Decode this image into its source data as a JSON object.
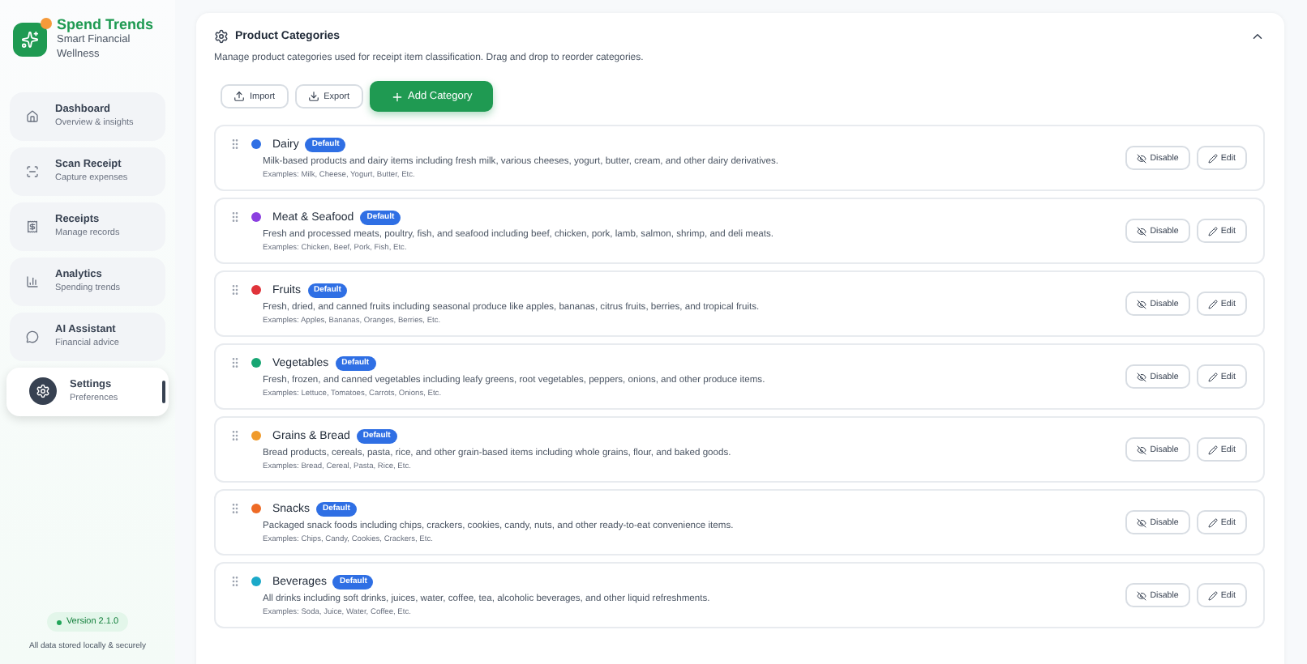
{
  "brand": {
    "name": "Spend Trends",
    "tagline": "Smart Financial Wellness"
  },
  "nav": [
    {
      "kind": "home",
      "label": "Dashboard",
      "sub": "Overview & insights",
      "selected": false
    },
    {
      "kind": "scan",
      "label": "Scan Receipt",
      "sub": "Capture expenses",
      "selected": false
    },
    {
      "kind": "receipt",
      "label": "Receipts",
      "sub": "Manage records",
      "selected": false
    },
    {
      "kind": "chart",
      "label": "Analytics",
      "sub": "Spending trends",
      "selected": false
    },
    {
      "kind": "chat",
      "label": "AI Assistant",
      "sub": "Financial advice",
      "selected": false
    },
    {
      "kind": "gear",
      "label": "Settings",
      "sub": "Preferences",
      "selected": true
    }
  ],
  "footer": {
    "version": "Version 2.1.0",
    "note": "All data stored locally & securely"
  },
  "panel": {
    "title": "Product Categories",
    "description": "Manage product categories used for receipt item classification. Drag and drop to reorder categories.",
    "expanded": true,
    "buttons": [
      {
        "kind": "import",
        "label": "Import"
      },
      {
        "kind": "export",
        "label": "Export"
      },
      {
        "kind": "add",
        "label": "Add Category"
      }
    ],
    "categories": [
      {
        "name": "Dairy",
        "badge": "Default",
        "color": "#2f6fe4",
        "description": "Milk-based products and dairy items including fresh milk, various cheeses, yogurt, butter, cream, and other dairy derivatives.",
        "examples": "Examples: Milk, Cheese, Yogurt, Butter, Etc.",
        "disable": "Disable",
        "edit": "Edit"
      },
      {
        "name": "Meat & Seafood",
        "badge": "Default",
        "color": "#8b3fe0",
        "description": "Fresh and processed meats, poultry, fish, and seafood including beef, chicken, pork, lamb, salmon, shrimp, and deli meats.",
        "examples": "Examples: Chicken, Beef, Pork, Fish, Etc.",
        "disable": "Disable",
        "edit": "Edit"
      },
      {
        "name": "Fruits",
        "badge": "Default",
        "color": "#e0333a",
        "description": "Fresh, dried, and canned fruits including seasonal produce like apples, bananas, citrus fruits, berries, and tropical fruits.",
        "examples": "Examples: Apples, Bananas, Oranges, Berries, Etc.",
        "disable": "Disable",
        "edit": "Edit"
      },
      {
        "name": "Vegetables",
        "badge": "Default",
        "color": "#17a673",
        "description": "Fresh, frozen, and canned vegetables including leafy greens, root vegetables, peppers, onions, and other produce items.",
        "examples": "Examples: Lettuce, Tomatoes, Carrots, Onions, Etc.",
        "disable": "Disable",
        "edit": "Edit"
      },
      {
        "name": "Grains & Bread",
        "badge": "Default",
        "color": "#f09a2a",
        "description": "Bread products, cereals, pasta, rice, and other grain-based items including whole grains, flour, and baked goods.",
        "examples": "Examples: Bread, Cereal, Pasta, Rice, Etc.",
        "disable": "Disable",
        "edit": "Edit"
      },
      {
        "name": "Snacks",
        "badge": "Default",
        "color": "#ee6a25",
        "description": "Packaged snack foods including chips, crackers, cookies, candy, nuts, and other ready-to-eat convenience items.",
        "examples": "Examples: Chips, Candy, Cookies, Crackers, Etc.",
        "disable": "Disable",
        "edit": "Edit"
      },
      {
        "name": "Beverages",
        "badge": "Default",
        "color": "#1ba9c9",
        "description": "All drinks including soft drinks, juices, water, coffee, tea, alcoholic beverages, and other liquid refreshments.",
        "examples": "Examples: Soda, Juice, Water, Coffee, Etc.",
        "disable": "Disable",
        "edit": "Edit"
      }
    ]
  }
}
